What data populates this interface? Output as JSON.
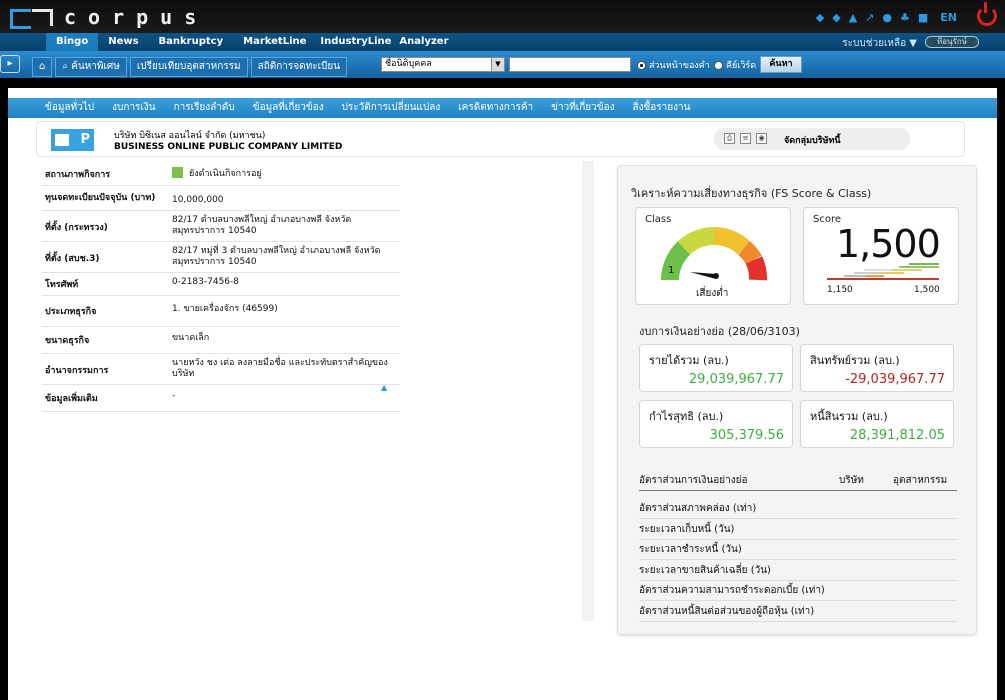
{
  "brand": {
    "logo_text": "corpus"
  },
  "topbar": {
    "icons": [
      "arrow-left-icon",
      "arrow-right-icon",
      "home-icon",
      "expand-icon",
      "user-icon",
      "org-chart-icon",
      "document-icon"
    ],
    "lang": "EN"
  },
  "nav": {
    "items": [
      "Bingo",
      "News",
      "Bankruptcy",
      "MarketLine",
      "IndustryLine",
      "Analyzer"
    ],
    "active": "Bingo",
    "help": "ระบบช่วยเหลือ ▼",
    "more": "ที่อนุรักษ์"
  },
  "toolbar": {
    "tabs": [
      "ค้นหาพิเศษ",
      "เปรียบเทียบอุตสาหกรรม",
      "สถิติการจดทะเบียน"
    ],
    "select_value": "ชื่อนิติบุคคล",
    "input_value": "",
    "radio1": "ส่วนหน้าของคำ",
    "radio2": "คีย์เวิร์ด",
    "search_button": "ค้นหา"
  },
  "subnav": {
    "items": [
      "ข้อมูลทั่วไป",
      "งบการเงิน",
      "การเรียงลำดับ",
      "ข้อมูลที่เกี่ยวข้อง",
      "ประวัติการเปลี่ยนแปลง",
      "เครดิตทางการค้า",
      "ข่าวที่เกี่ยวข้อง",
      "สิ่งซื้อรายงาน"
    ]
  },
  "company": {
    "icon_letter": "P",
    "name_th": "บริษัท บิซิเนส ออนไลน์ จำกัด (มหาชน)",
    "name_en": "BUSINESS ONLINE PUBLIC COMPANY LIMITED",
    "group_link": "จัดกลุ่มบริษัทนี้"
  },
  "info": [
    {
      "key": "สถานภาพกิจการ",
      "value": "ยังดำเนินกิจการอยู่"
    },
    {
      "key": "ทุนจดทะเบียนปัจจุบัน (บาท)",
      "value": "10,000,000"
    },
    {
      "key": "ที่ตั้ง (กระทรวง)",
      "value": "82/17 ตำบลบางพลีใหญ่ อำเภอบางพลี จังหวัดสมุทรปราการ 10540"
    },
    {
      "key": "ที่ตั้ง (สบช.3)",
      "value": "82/17 หมู่ที่ 3 ตำบลบางพลีใหญ่ อำเภอบางพลี จังหวัด สมุทรปราการ 10540"
    },
    {
      "key": "โทรศัพท์",
      "value": "0-2183-7456-8"
    },
    {
      "key": "ประเภทธุรกิจ",
      "value": "1. ขายเครื่องจักร (46599)"
    },
    {
      "key": "ขนาดธุรกิจ",
      "value": "ขนาดเล็ก"
    },
    {
      "key": "อำนาจกรรมการ",
      "value": "นายหวัง ชง เต่อ ลงลายมือชื่อ และประทับตราสำคัญของบริษัท"
    },
    {
      "key": "ข้อมูลเพิ่มเติม",
      "value": "-"
    }
  ],
  "risk": {
    "title": "วิเคราะห์ความเสี่ยงทางธุรกิจ (FS Score & Class)",
    "class_label": "Class",
    "class_value": "1",
    "risk_text": "เสี่ยงต่ำ",
    "score_label": "Score",
    "score_value": "1,500",
    "score_min": "1,150",
    "score_max": "1,500",
    "gauge_colors": [
      "#6cc04a",
      "#c8d940",
      "#f2c12e",
      "#ef8a2a",
      "#e2322a"
    ]
  },
  "financials": {
    "title": "งบการเงินอย่างย่อ (28/06/3103)",
    "cards": [
      {
        "label": "รายได้รวม (ลบ.)",
        "value": "29,039,967.77",
        "sign": "pos"
      },
      {
        "label": "สินทรัพย์รวม (ลบ.)",
        "value": "-29,039,967.77",
        "sign": "neg"
      },
      {
        "label": "กำไรสุทธิ (ลบ.)",
        "value": "305,379.56",
        "sign": "pos"
      },
      {
        "label": "หนี้สินรวม (ลบ.)",
        "value": "28,391,812.05",
        "sign": "pos"
      }
    ]
  },
  "ratios": {
    "title": "อัตราส่วนการเงินอย่างย่อ",
    "col_company": "บริษัท",
    "col_industry": "อุตสาหกรรม",
    "rows": [
      "อัตราส่วนสภาพคล่อง (เท่า)",
      "ระยะเวลาเก็บหนี้ (วัน)",
      "ระยะเวลาชำระหนี้ (วัน)",
      "ระยะเวลาขายสินค้าเฉลี่ย (วัน)",
      "อัตราส่วนความสามารถชำระดอกเบี้ย (เท่า)",
      "อัตราส่วนหนี้สินต่อส่วนของผู้ถือหุ้น (เท่า)"
    ]
  }
}
